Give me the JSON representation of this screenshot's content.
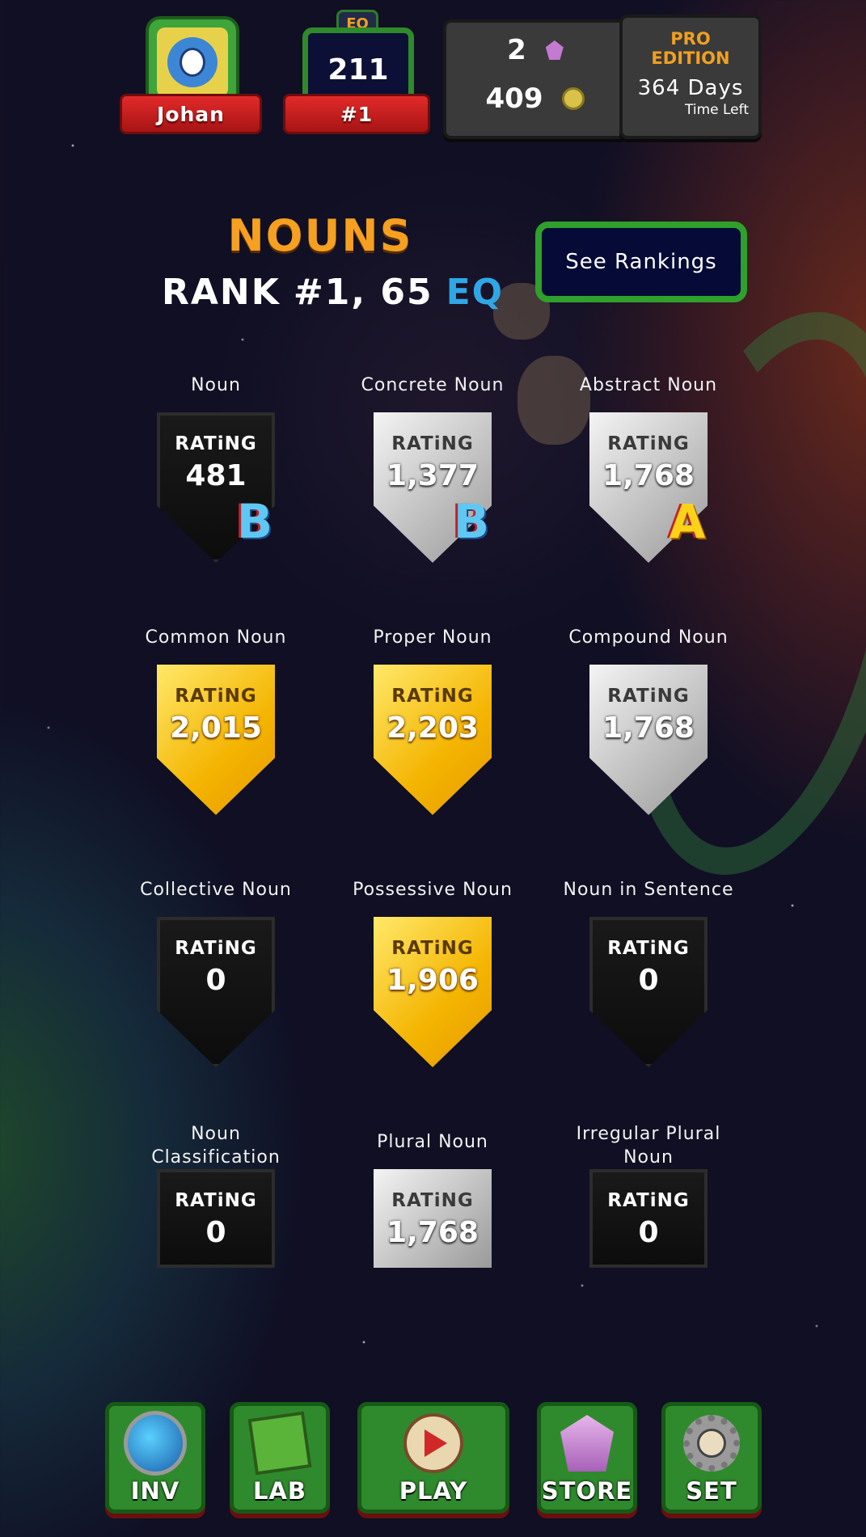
{
  "profile": {
    "name": "Johan"
  },
  "eq": {
    "tag": "EQ",
    "value": "211",
    "rank": "#1"
  },
  "currency": {
    "gems": "2",
    "coins": "409"
  },
  "pro": {
    "line1": "PRO",
    "line2": "EDITION",
    "days": "364 Days",
    "time_left": "Time Left"
  },
  "header": {
    "title": "NOUNS",
    "rank_label": "RANK",
    "rank_value": "#1, 65",
    "eq_label": "EQ",
    "see_rankings": "See Rankings"
  },
  "rating_label": "RATiNG",
  "skills": [
    {
      "label": "Noun",
      "rating": "481",
      "tier": "dark",
      "grade": "B"
    },
    {
      "label": "Concrete Noun",
      "rating": "1,377",
      "tier": "silver",
      "grade": "B"
    },
    {
      "label": "Abstract Noun",
      "rating": "1,768",
      "tier": "silver",
      "grade": "A"
    },
    {
      "label": "Common Noun",
      "rating": "2,015",
      "tier": "gold",
      "grade": ""
    },
    {
      "label": "Proper Noun",
      "rating": "2,203",
      "tier": "gold",
      "grade": ""
    },
    {
      "label": "Compound Noun",
      "rating": "1,768",
      "tier": "silver",
      "grade": ""
    },
    {
      "label": "Collective Noun",
      "rating": "0",
      "tier": "dark",
      "grade": ""
    },
    {
      "label": "Possessive Noun",
      "rating": "1,906",
      "tier": "gold",
      "grade": ""
    },
    {
      "label": "Noun in Sentence",
      "rating": "0",
      "tier": "dark",
      "grade": ""
    },
    {
      "label": "Noun Classification",
      "rating": "0",
      "tier": "dark",
      "grade": ""
    },
    {
      "label": "Plural Noun",
      "rating": "1,768",
      "tier": "silver",
      "grade": ""
    },
    {
      "label": "Irregular Plural Noun",
      "rating": "0",
      "tier": "dark",
      "grade": ""
    }
  ],
  "nav": [
    {
      "label": "INV",
      "icon": "helmet-icon"
    },
    {
      "label": "LAB",
      "icon": "slime-cube-icon"
    },
    {
      "label": "PLAY",
      "icon": "play-icon"
    },
    {
      "label": "STORE",
      "icon": "gem-icon"
    },
    {
      "label": "SET",
      "icon": "gear-icon"
    }
  ]
}
